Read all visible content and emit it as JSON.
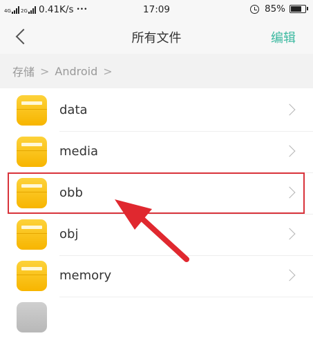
{
  "status_bar": {
    "signal1": "4G",
    "signal2": "2G",
    "speed": "0.41K/s",
    "more": "•••",
    "time": "17:09",
    "battery": "85%",
    "battery_level": 0.85,
    "alarm_icon": "alarm-clock-icon"
  },
  "nav": {
    "back_icon": "chevron-left-icon",
    "title": "所有文件",
    "edit_label": "编辑",
    "accent_color": "#3cb9a0"
  },
  "breadcrumb": {
    "root": "存储",
    "sep": ">",
    "current": "Android"
  },
  "files": [
    {
      "name": "data"
    },
    {
      "name": "media"
    },
    {
      "name": "obb"
    },
    {
      "name": "obj"
    },
    {
      "name": "memory"
    }
  ],
  "annotation": {
    "highlight_color": "#d8323a",
    "highlighted_item": "obb"
  }
}
